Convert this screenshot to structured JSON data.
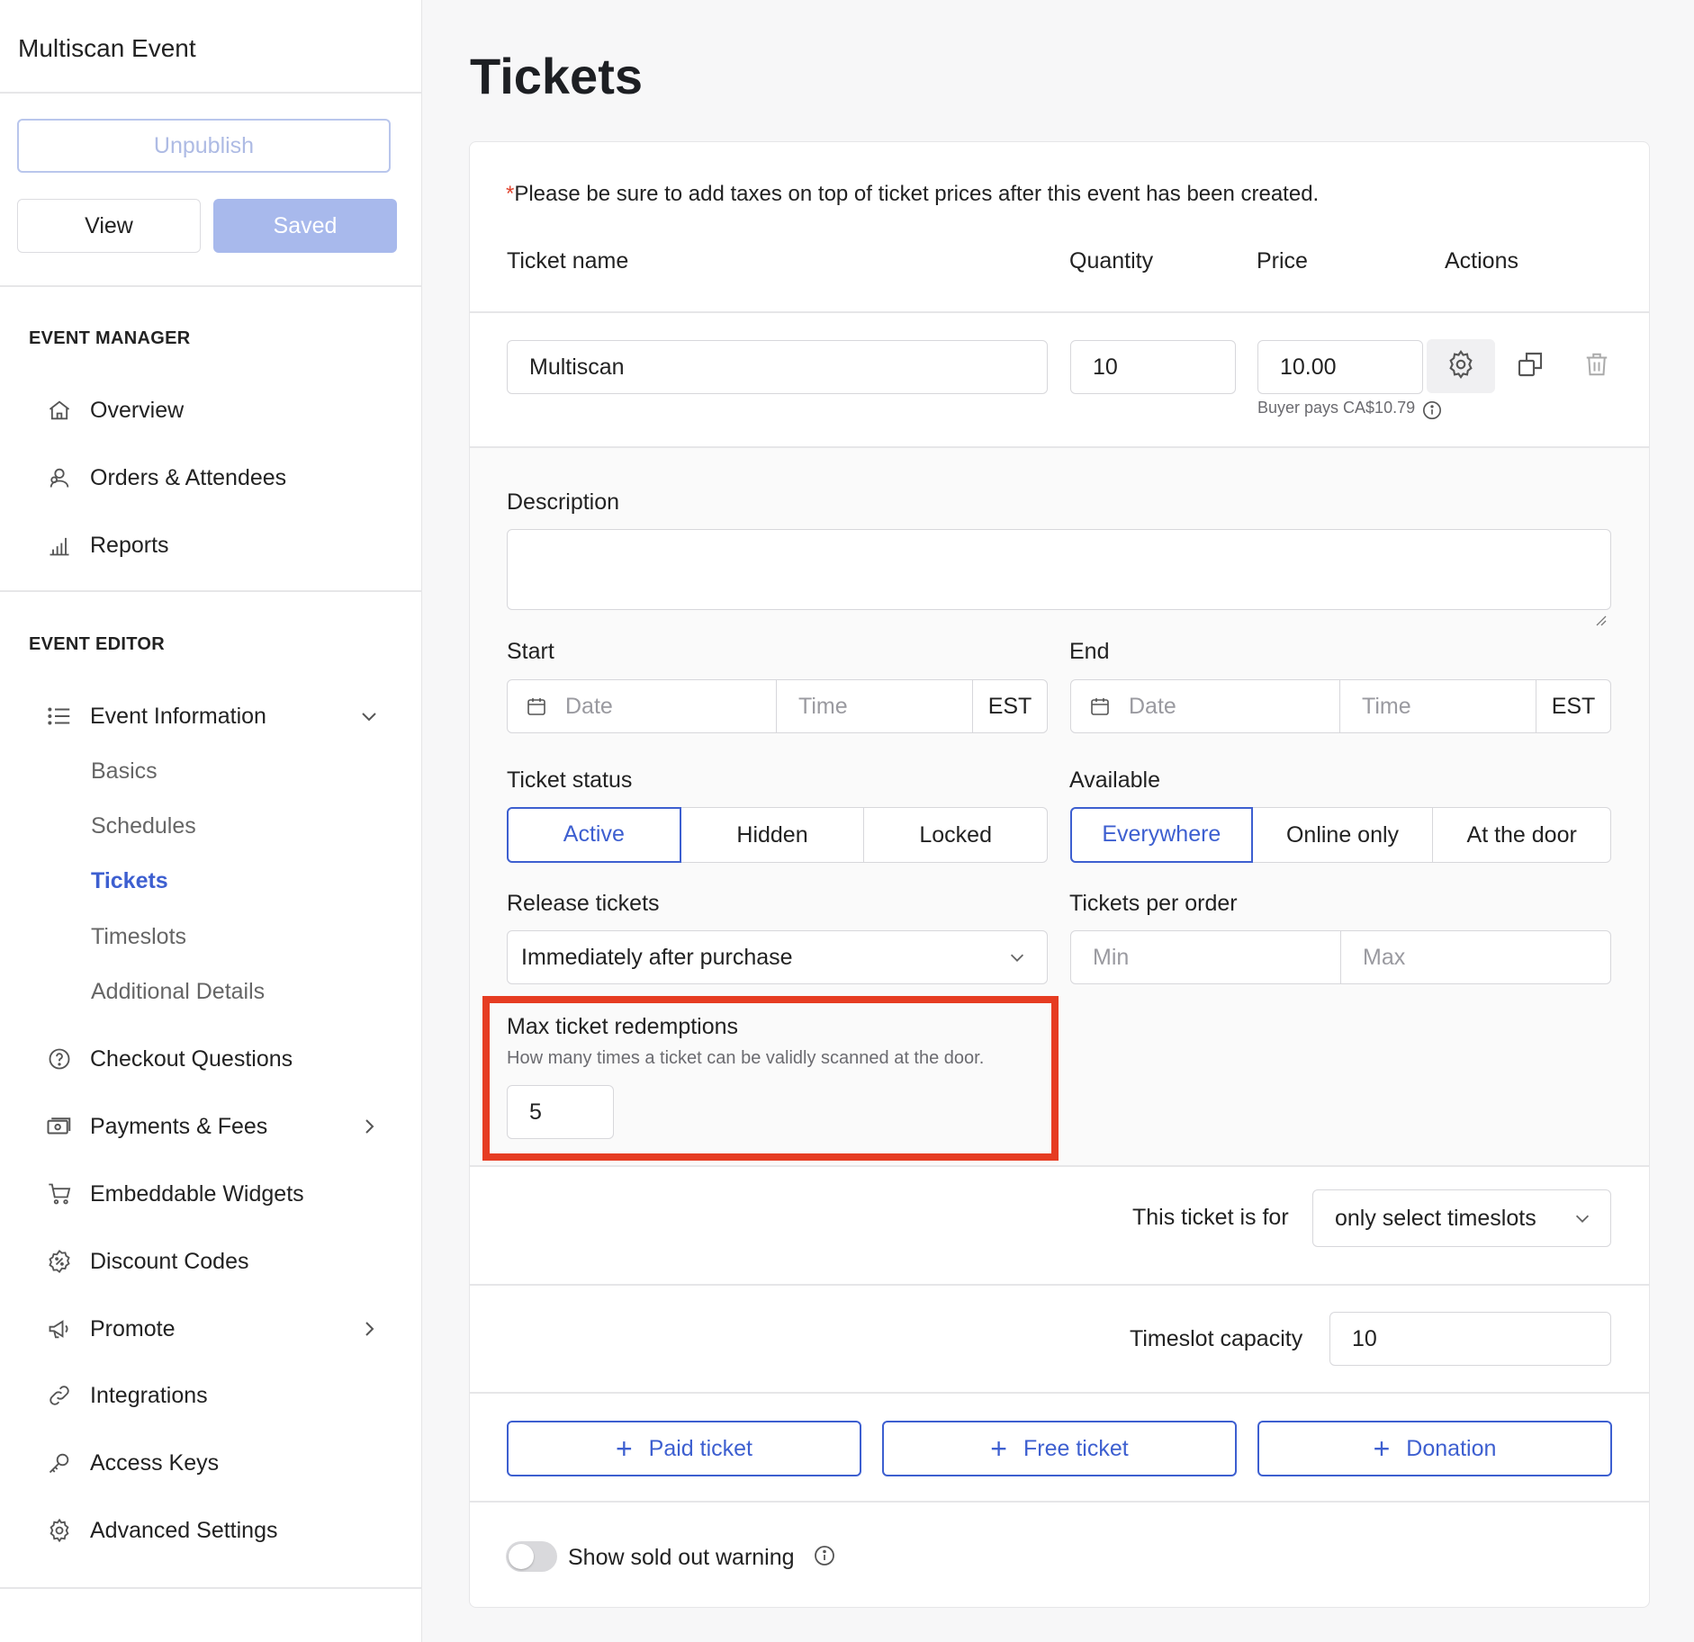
{
  "sidebar": {
    "event_title": "Multiscan Event",
    "unpublish_label": "Unpublish",
    "view_label": "View",
    "saved_label": "Saved",
    "event_manager_title": "EVENT MANAGER",
    "event_manager_items": [
      {
        "label": "Overview",
        "icon": "home-icon"
      },
      {
        "label": "Orders & Attendees",
        "icon": "users-icon"
      },
      {
        "label": "Reports",
        "icon": "bar-chart-icon"
      }
    ],
    "event_editor_title": "EVENT EDITOR",
    "event_information_label": "Event Information",
    "event_information_subitems": [
      {
        "label": "Basics",
        "active": false
      },
      {
        "label": "Schedules",
        "active": false
      },
      {
        "label": "Tickets",
        "active": true
      },
      {
        "label": "Timeslots",
        "active": false
      },
      {
        "label": "Additional Details",
        "active": false
      }
    ],
    "editor_items": [
      {
        "label": "Checkout Questions",
        "icon": "question-circle-icon"
      },
      {
        "label": "Payments & Fees",
        "icon": "money-icon"
      },
      {
        "label": "Embeddable Widgets",
        "icon": "cart-icon"
      },
      {
        "label": "Discount Codes",
        "icon": "discount-badge-icon"
      },
      {
        "label": "Promote",
        "icon": "megaphone-icon"
      },
      {
        "label": "Integrations",
        "icon": "link-icon"
      },
      {
        "label": "Access Keys",
        "icon": "key-icon"
      },
      {
        "label": "Advanced Settings",
        "icon": "gear-icon"
      }
    ]
  },
  "main": {
    "page_title": "Tickets",
    "notice_asterisk": "*",
    "notice": "Please be sure to add taxes on top of ticket prices after this event has been created.",
    "columns": {
      "name": "Ticket name",
      "quantity": "Quantity",
      "price": "Price",
      "actions": "Actions"
    },
    "ticket": {
      "name": "Multiscan",
      "quantity": "10",
      "price": "10.00",
      "buyer_pays": "Buyer pays CA$10.79"
    },
    "description_label": "Description",
    "start_label": "Start",
    "end_label": "End",
    "date_placeholder": "Date",
    "time_placeholder": "Time",
    "timezone": "EST",
    "ticket_status_label": "Ticket status",
    "ticket_status_options": [
      "Active",
      "Hidden",
      "Locked"
    ],
    "ticket_status_selected": "Active",
    "available_label": "Available",
    "available_options": [
      "Everywhere",
      "Online only",
      "At the door"
    ],
    "available_selected": "Everywhere",
    "release_label": "Release tickets",
    "release_value": "Immediately after purchase",
    "per_order_label": "Tickets per order",
    "min_placeholder": "Min",
    "max_placeholder": "Max",
    "max_redemptions_label": "Max ticket redemptions",
    "max_redemptions_hint": "How many times a ticket can be validly scanned at the door.",
    "max_redemptions_value": "5",
    "ticket_for_label": "This ticket is for",
    "ticket_for_value": "only select timeslots",
    "timeslot_capacity_label": "Timeslot capacity",
    "timeslot_capacity_value": "10",
    "add_buttons": [
      "Paid ticket",
      "Free ticket",
      "Donation"
    ],
    "sold_out_label": "Show sold out warning"
  },
  "colors": {
    "accent": "#3d5fd0",
    "highlight": "#e63c22",
    "saved_button": "#a8b9ec"
  }
}
